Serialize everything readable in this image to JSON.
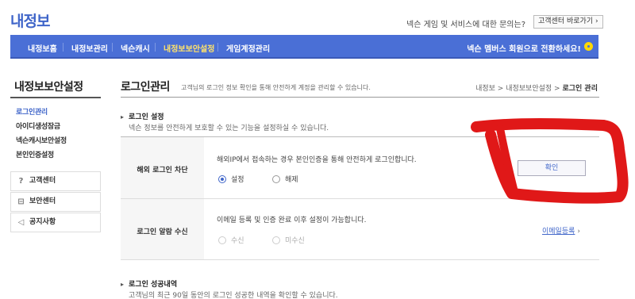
{
  "header": {
    "logo": "내정보",
    "inquiry": "넥슨 게임 및 서비스에 대한 문의는?",
    "cs_button": "고객센터 바로가기 ›"
  },
  "nav": {
    "items": [
      "내정보홈",
      "내정보관리",
      "넥슨캐시",
      "내정보보안설정",
      "게임계정관리"
    ],
    "active_index": 3,
    "promo": "넥슨 멤버스 회원으로 전환하세요!"
  },
  "sidebar": {
    "title": "내정보보안설정",
    "menu": [
      "로그인관리",
      "아이디생성잠금",
      "넥슨캐시보안설정",
      "본인인증설정"
    ],
    "active_index": 0,
    "boxes": [
      {
        "label": "고객센터",
        "icon": "question-circle-icon"
      },
      {
        "label": "보안센터",
        "icon": "lock-icon"
      },
      {
        "label": "공지사항",
        "icon": "megaphone-icon"
      }
    ]
  },
  "main": {
    "title": "로그인관리",
    "description": "고객님의 로그인 정보 확인을 통해 안전하게 계정을 관리할 수 있습니다.",
    "breadcrumb": [
      "내정보",
      "내정보보안설정",
      "로그인 관리"
    ],
    "section1": {
      "title": "로그인 설정",
      "desc": "넥슨 정보를 안전하게 보호할 수 있는 기능을 설정하실 수 있습니다."
    },
    "row1": {
      "label": "해외 로그인 차단",
      "text": "해외IP에서 접속하는 경우 본인인증을 통해 안전하게 로그인합니다.",
      "options": [
        "설정",
        "해제"
      ],
      "selected": 0,
      "button": "확인"
    },
    "row2": {
      "label": "로그인 알람 수신",
      "text": "이메일 등록 및 인증 완료 이후 설정이 가능합니다.",
      "options": [
        "수신",
        "미수신"
      ],
      "link": "이메일등록"
    },
    "section2": {
      "title": "로그인 성공내역",
      "desc": "고객님의 최근 90일 동안의 로그인 성공한 내역을 확인할 수 있습니다."
    }
  },
  "colors": {
    "nav_blue": "#4a6fd6",
    "accent": "#3f65c9",
    "annotation_red": "#e01818"
  }
}
